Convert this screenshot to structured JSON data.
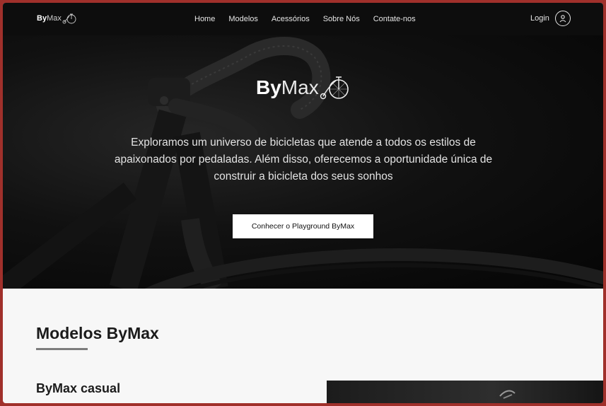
{
  "brand": {
    "bold": "By",
    "light": "Max"
  },
  "nav": {
    "links": [
      "Home",
      "Modelos",
      "Acessórios",
      "Sobre Nós",
      "Contate-nos"
    ],
    "login_label": "Login"
  },
  "hero": {
    "description": "Exploramos um universo de bicicletas que atende a todos os estilos de apaixonados por pedaladas. Além disso, oferecemos a oportunidade única de construir a bicicleta dos seus sonhos",
    "cta_label": "Conhecer o Playground ByMax"
  },
  "models": {
    "section_title": "Modelos ByMax",
    "first_model_name": "ByMax casual"
  },
  "icons": {
    "logo": "penny-farthing-bicycle-icon",
    "login": "user-circle-icon"
  },
  "colors": {
    "frame_border": "#a0302b",
    "nav_bg": "#0d0d0d",
    "hero_bg": "#0a0a0a",
    "accent_bar": "#7d7d7d"
  }
}
